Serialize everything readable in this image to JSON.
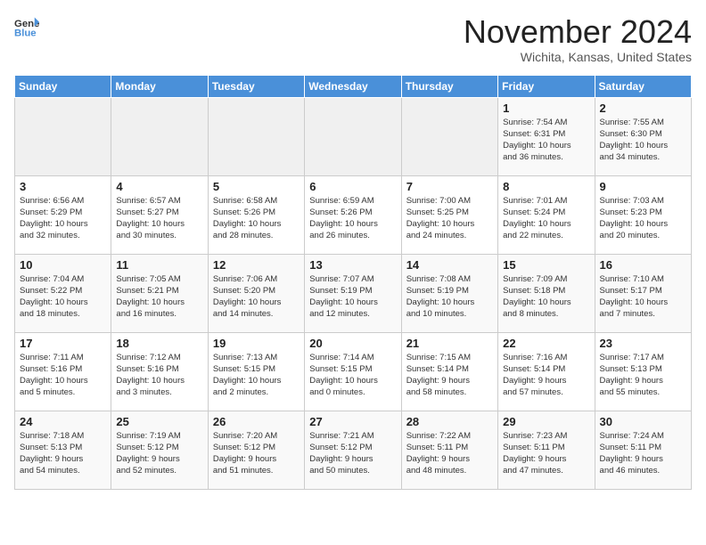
{
  "header": {
    "logo_general": "General",
    "logo_blue": "Blue",
    "month_title": "November 2024",
    "location": "Wichita, Kansas, United States"
  },
  "weekdays": [
    "Sunday",
    "Monday",
    "Tuesday",
    "Wednesday",
    "Thursday",
    "Friday",
    "Saturday"
  ],
  "weeks": [
    [
      {
        "day": "",
        "info": ""
      },
      {
        "day": "",
        "info": ""
      },
      {
        "day": "",
        "info": ""
      },
      {
        "day": "",
        "info": ""
      },
      {
        "day": "",
        "info": ""
      },
      {
        "day": "1",
        "info": "Sunrise: 7:54 AM\nSunset: 6:31 PM\nDaylight: 10 hours\nand 36 minutes."
      },
      {
        "day": "2",
        "info": "Sunrise: 7:55 AM\nSunset: 6:30 PM\nDaylight: 10 hours\nand 34 minutes."
      }
    ],
    [
      {
        "day": "3",
        "info": "Sunrise: 6:56 AM\nSunset: 5:29 PM\nDaylight: 10 hours\nand 32 minutes."
      },
      {
        "day": "4",
        "info": "Sunrise: 6:57 AM\nSunset: 5:27 PM\nDaylight: 10 hours\nand 30 minutes."
      },
      {
        "day": "5",
        "info": "Sunrise: 6:58 AM\nSunset: 5:26 PM\nDaylight: 10 hours\nand 28 minutes."
      },
      {
        "day": "6",
        "info": "Sunrise: 6:59 AM\nSunset: 5:26 PM\nDaylight: 10 hours\nand 26 minutes."
      },
      {
        "day": "7",
        "info": "Sunrise: 7:00 AM\nSunset: 5:25 PM\nDaylight: 10 hours\nand 24 minutes."
      },
      {
        "day": "8",
        "info": "Sunrise: 7:01 AM\nSunset: 5:24 PM\nDaylight: 10 hours\nand 22 minutes."
      },
      {
        "day": "9",
        "info": "Sunrise: 7:03 AM\nSunset: 5:23 PM\nDaylight: 10 hours\nand 20 minutes."
      }
    ],
    [
      {
        "day": "10",
        "info": "Sunrise: 7:04 AM\nSunset: 5:22 PM\nDaylight: 10 hours\nand 18 minutes."
      },
      {
        "day": "11",
        "info": "Sunrise: 7:05 AM\nSunset: 5:21 PM\nDaylight: 10 hours\nand 16 minutes."
      },
      {
        "day": "12",
        "info": "Sunrise: 7:06 AM\nSunset: 5:20 PM\nDaylight: 10 hours\nand 14 minutes."
      },
      {
        "day": "13",
        "info": "Sunrise: 7:07 AM\nSunset: 5:19 PM\nDaylight: 10 hours\nand 12 minutes."
      },
      {
        "day": "14",
        "info": "Sunrise: 7:08 AM\nSunset: 5:19 PM\nDaylight: 10 hours\nand 10 minutes."
      },
      {
        "day": "15",
        "info": "Sunrise: 7:09 AM\nSunset: 5:18 PM\nDaylight: 10 hours\nand 8 minutes."
      },
      {
        "day": "16",
        "info": "Sunrise: 7:10 AM\nSunset: 5:17 PM\nDaylight: 10 hours\nand 7 minutes."
      }
    ],
    [
      {
        "day": "17",
        "info": "Sunrise: 7:11 AM\nSunset: 5:16 PM\nDaylight: 10 hours\nand 5 minutes."
      },
      {
        "day": "18",
        "info": "Sunrise: 7:12 AM\nSunset: 5:16 PM\nDaylight: 10 hours\nand 3 minutes."
      },
      {
        "day": "19",
        "info": "Sunrise: 7:13 AM\nSunset: 5:15 PM\nDaylight: 10 hours\nand 2 minutes."
      },
      {
        "day": "20",
        "info": "Sunrise: 7:14 AM\nSunset: 5:15 PM\nDaylight: 10 hours\nand 0 minutes."
      },
      {
        "day": "21",
        "info": "Sunrise: 7:15 AM\nSunset: 5:14 PM\nDaylight: 9 hours\nand 58 minutes."
      },
      {
        "day": "22",
        "info": "Sunrise: 7:16 AM\nSunset: 5:14 PM\nDaylight: 9 hours\nand 57 minutes."
      },
      {
        "day": "23",
        "info": "Sunrise: 7:17 AM\nSunset: 5:13 PM\nDaylight: 9 hours\nand 55 minutes."
      }
    ],
    [
      {
        "day": "24",
        "info": "Sunrise: 7:18 AM\nSunset: 5:13 PM\nDaylight: 9 hours\nand 54 minutes."
      },
      {
        "day": "25",
        "info": "Sunrise: 7:19 AM\nSunset: 5:12 PM\nDaylight: 9 hours\nand 52 minutes."
      },
      {
        "day": "26",
        "info": "Sunrise: 7:20 AM\nSunset: 5:12 PM\nDaylight: 9 hours\nand 51 minutes."
      },
      {
        "day": "27",
        "info": "Sunrise: 7:21 AM\nSunset: 5:12 PM\nDaylight: 9 hours\nand 50 minutes."
      },
      {
        "day": "28",
        "info": "Sunrise: 7:22 AM\nSunset: 5:11 PM\nDaylight: 9 hours\nand 48 minutes."
      },
      {
        "day": "29",
        "info": "Sunrise: 7:23 AM\nSunset: 5:11 PM\nDaylight: 9 hours\nand 47 minutes."
      },
      {
        "day": "30",
        "info": "Sunrise: 7:24 AM\nSunset: 5:11 PM\nDaylight: 9 hours\nand 46 minutes."
      }
    ]
  ]
}
